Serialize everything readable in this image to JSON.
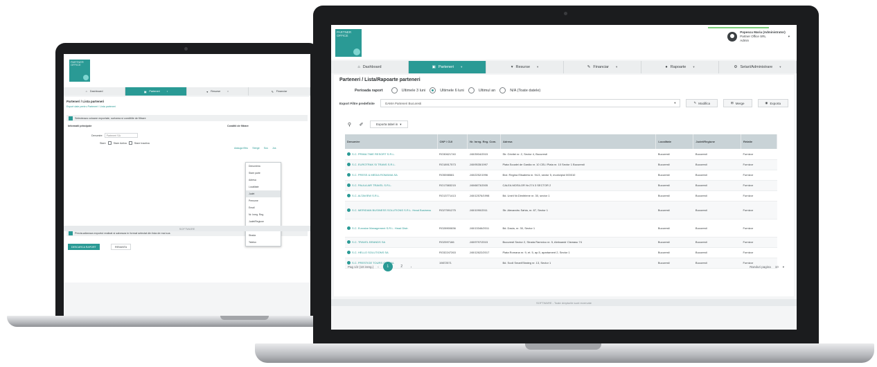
{
  "small": {
    "logo_text": "PARTNER OFFICE",
    "nav": [
      {
        "label": "Dashboard",
        "icon": "home-icon"
      },
      {
        "label": "Parteneri",
        "icon": "users-icon"
      },
      {
        "label": "Resurse",
        "icon": "cart-icon"
      },
      {
        "label": "Financiar",
        "icon": "chart-icon"
      }
    ],
    "title": "Parteneri / Lista parteneri",
    "subtitle": "Export date pentru Parteneri / Lista parteneri",
    "section1": "Selecteaza coloane exportate, sortarea si conditiile de filtrare",
    "col_left_head": "Informatii principale",
    "col_right_head": "Conditii de filtrare",
    "field_den_label": "Denumire",
    "field_den_value": "Parteneri SA",
    "field_stare_label": "Stare",
    "opt1": "Stare Activa",
    "opt2": "Stare Inactiva",
    "filter_links": [
      "Adauga filtru",
      "Sterge",
      "Sus",
      "Jos"
    ],
    "dropdown": [
      "Denumirea",
      "Stare parte",
      "Adresa",
      "Localitate",
      "Judet",
      "Prenume",
      "Email",
      "Nr. Inreg. Reg.",
      "Judet/Regiune",
      "Localitate",
      "Strada",
      "Telefon"
    ],
    "section2": "Previzualizeaza exportul realizat si salveaza in format selectat din lista de mai sus",
    "btn_export": "DESCARCA RAPORT",
    "btn_cancel": "RENUNTA",
    "footer": "SOFTWARE"
  },
  "big": {
    "logo_text": "PARTNER OFFICE",
    "user_name": "Popescu Maria (Administrator)",
    "user_company": "Partner Office SRL",
    "user_role": "Admin",
    "nav": [
      {
        "label": "Dashboard",
        "icon": "home-icon"
      },
      {
        "label": "Parteneri",
        "icon": "users-icon"
      },
      {
        "label": "Resurse",
        "icon": "cart-icon"
      },
      {
        "label": "Financiar",
        "icon": "chart-icon"
      },
      {
        "label": "Rapoarte",
        "icon": "report-icon"
      },
      {
        "label": "Setari/Administrare",
        "icon": "gear-icon"
      }
    ],
    "title": "Parteneri / Lista/Rapoarte parteneri",
    "period_label": "Perioada raport",
    "radios": [
      {
        "label": "Ultimele 3 luni",
        "on": false
      },
      {
        "label": "Ultimele 6 luni",
        "on": true
      },
      {
        "label": "Ultimul an",
        "on": false
      },
      {
        "label": "N/A (Toate datele)",
        "on": false
      }
    ],
    "filter_label": "Export Filtre predefinite",
    "filter_value": "GAMA Parteneri Bucuresti",
    "btn_modify": "Modifica",
    "btn_merge": "Merge",
    "btn_export": "Exporta",
    "export_select": "Exporta tabel in",
    "columns": [
      "Denumire",
      "CNP / CUI",
      "Nr. Inreg. Reg. Com.",
      "Adresa",
      "Localitate",
      "Judet/Regiune",
      "Relatie"
    ],
    "rows": [
      {
        "name": "S.C. PRIMA TIME RESORT S.R.L.",
        "cui": "RO30621740",
        "reg": "J40/3904/2015",
        "addr": "Str. Grivitei nr. 2, Sector 4, Bucuresti",
        "loc": "Bucuresti",
        "jud": "Bucuresti",
        "rel": "Furnizor"
      },
      {
        "name": "S.C. EUROTRAK SI TRANS S.R.L.",
        "cui": "RO18917573",
        "reg": "J40/9535/1997",
        "addr": "Piata Scoalei de Gardia nr. 10 CELI Piata nr. 10 Sector 1 Bucuresti",
        "loc": "Bucuresti",
        "jud": "Bucuresti",
        "rel": "Furnizor"
      },
      {
        "name": "S.C. PRESS & MEDIA ROMANIA SA",
        "cui": "RO5598581",
        "reg": "J40/2252/1996",
        "addr": "Bvd. Regina Elisabeta nr. 94-5, sector 5, municipiul 000010",
        "loc": "Bucuresti",
        "jud": "Bucuresti",
        "rel": "Furnizor"
      },
      {
        "name": "S.C. PAULA AIR TRAVEL S.R.L.",
        "cui": "RO17583215",
        "reg": "J40/6873/2005",
        "addr": "CALEA MOSILOR Nr.274 3 SECTOR 2",
        "loc": "Bucuresti",
        "jud": "Bucuresti",
        "rel": "Furnizor"
      },
      {
        "name": "S.C. ALTAVIEW S.R.L.",
        "cui": "RO13771413",
        "reg": "J40/12576/1998",
        "addr": "Bd. Unirii Nr.Dimitriene nr. 30, sector 1",
        "loc": "Bucuresti",
        "jud": "Bucuresti",
        "rel": "Furnizor"
      },
      {
        "name": "S.C. MERIDIAN BUSINESS SOLUTIONS S.R.L. Head Business",
        "cui": "RO27591275",
        "reg": "J40/1090/2011",
        "addr": "Str. Alexandru Sahia, nr. 87, Sector 1",
        "loc": "Bucuresti",
        "jud": "Bucuresti",
        "rel": "Furnizor",
        "tall": true
      },
      {
        "name": "S.C. Eurostar Management S.R.L. Head Distr.",
        "cui": "RO28900836",
        "reg": "J40/13346/2011",
        "addr": "Bd. Dacia, nr. 30, Sector 1",
        "loc": "Bucuresti",
        "jud": "Bucuresti",
        "rel": "Furnizor",
        "tall": true
      },
      {
        "name": "S.C. TRAVEL BRANDS SA",
        "cui": "RO2597166",
        "reg": "J40/9797/2015",
        "addr": "Bucuresti Sector 2, Strada Ramnicu nr. 5, Aleksandr Cismasu 74",
        "loc": "Bucuresti",
        "jud": "Bucuresti",
        "rel": "Furnizor"
      },
      {
        "name": "S.C. HELLO SOLUTIONS SA",
        "cui": "RO32247263",
        "reg": "J40/12622/2017",
        "addr": "Piata Romana nr. 9, et. 5, ap.5, apartament 2, Sector 1",
        "loc": "Bucuresti",
        "jud": "Bucuresti",
        "rel": "Furnizor"
      },
      {
        "name": "S.C. PRESTIGE TOURS GLOBAL",
        "cui": "19872571",
        "reg": "",
        "addr": "Bd. Scoli Smart/Strateg nr. 13, Sector 1",
        "loc": "Bucuresti",
        "jud": "Bucuresti",
        "rel": "Furnizor"
      }
    ],
    "pager_text": "Pag 1/2 (10 inreg.)",
    "pages": [
      "1",
      "2"
    ],
    "per_page_label": "Randuri pagina",
    "per_page_value": "10",
    "footer": "SOFTWARE - Toate drepturile sunt rezervate"
  }
}
